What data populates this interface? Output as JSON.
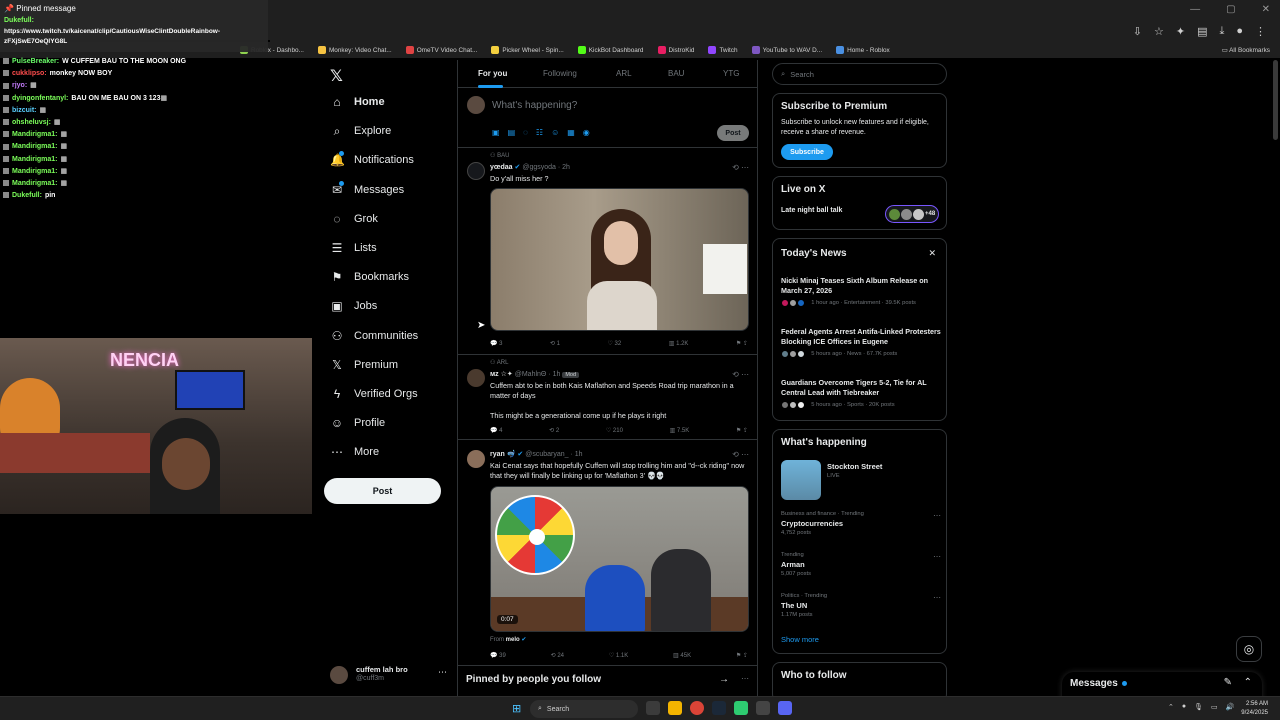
{
  "browser": {
    "bookmarks": [
      "Monkey: Video Chat...",
      "OmeTV Video Chat...",
      "Picker Wheel - Spin...",
      "KickBot Dashboard",
      "DistroKid",
      "Twitch",
      "YouTube to WAV D...",
      "Home - Roblox"
    ],
    "bookmark_partial": "Roblox - Dashbo...",
    "all_bookmarks": "All Bookmarks"
  },
  "chat": {
    "pinned_title": "Pinned message",
    "pinned_user": "Dukefull:",
    "pinned_text": "https://www.twitch.tv/kaicenat/clip/CautiousWiseClintDoubleRainbow-zFXjSwE7OeQlYG8L",
    "lines": [
      {
        "user": "PulseBreaker:",
        "color": "#6bff6b",
        "text": "W CUFFEM BAU TO THE MOON ONG"
      },
      {
        "user": "cukklipso:",
        "color": "#ff4d4d",
        "text": "monkey NOW BOY"
      },
      {
        "user": "rjyo:",
        "color": "#c77dff",
        "text": "▦"
      },
      {
        "user": "dyingonfentanyl:",
        "color": "#7cff5a",
        "text": "BAU ON ME BAU ON 3 123▦"
      },
      {
        "user": "bizcuit:",
        "color": "#5ad1ff",
        "text": "▦"
      },
      {
        "user": "ohsheluvsj:",
        "color": "#7cff5a",
        "text": "▦"
      },
      {
        "user": "Mandirigma1:",
        "color": "#7cff5a",
        "text": "▦"
      },
      {
        "user": "Mandirigma1:",
        "color": "#7cff5a",
        "text": "▦"
      },
      {
        "user": "Mandirigma1:",
        "color": "#7cff5a",
        "text": "▦"
      },
      {
        "user": "Mandirigma1:",
        "color": "#7cff5a",
        "text": "▦"
      },
      {
        "user": "Mandirigma1:",
        "color": "#7cff5a",
        "text": "▦"
      },
      {
        "user": "Dukefull:",
        "color": "#7cff5a",
        "text": "pin"
      }
    ]
  },
  "webcam": {
    "neon": "NENCIA"
  },
  "sidebar": {
    "items": [
      {
        "label": "Home",
        "icon": "home-icon",
        "glyph": "⌂",
        "active": true
      },
      {
        "label": "Explore",
        "icon": "search-icon",
        "glyph": "⌕"
      },
      {
        "label": "Notifications",
        "icon": "bell-icon",
        "glyph": "🔔",
        "dot": true
      },
      {
        "label": "Messages",
        "icon": "envelope-icon",
        "glyph": "✉",
        "dot": true
      },
      {
        "label": "Grok",
        "icon": "grok-icon",
        "glyph": "◌"
      },
      {
        "label": "Lists",
        "icon": "list-icon",
        "glyph": "☰"
      },
      {
        "label": "Bookmarks",
        "icon": "bookmark-icon",
        "glyph": "⚑"
      },
      {
        "label": "Jobs",
        "icon": "briefcase-icon",
        "glyph": "▣"
      },
      {
        "label": "Communities",
        "icon": "communities-icon",
        "glyph": "⚇"
      },
      {
        "label": "Premium",
        "icon": "x-premium-icon",
        "glyph": "𝕏"
      },
      {
        "label": "Verified Orgs",
        "icon": "lightning-icon",
        "glyph": "ϟ"
      },
      {
        "label": "Profile",
        "icon": "profile-icon",
        "glyph": "☺"
      },
      {
        "label": "More",
        "icon": "more-circle-icon",
        "glyph": "⋯"
      }
    ],
    "post_label": "Post",
    "account": {
      "name": "cuffem lah bro",
      "handle": "@cuff3m"
    }
  },
  "feed": {
    "tabs": [
      "For you",
      "Following",
      "ARL",
      "BAU",
      "YTG"
    ],
    "composer_placeholder": "What's happening?",
    "composer_post": "Post",
    "tweets": [
      {
        "context": "BAU",
        "name": "yœdaa",
        "handle": "@ggsyoda · 2h",
        "text": "Do y'all miss her ?",
        "actions": [
          "3",
          "1",
          "32",
          "1.2K"
        ]
      },
      {
        "context": "ARL",
        "name": "мz",
        "badge": "Mod",
        "handle": "@MahlnΘ · 1h",
        "text": "Cuffem abt to be in both Kais Maflathon and Speeds Road trip marathon in a matter of days",
        "text2": "This might be a generational come up if he plays it right",
        "actions": [
          "4",
          "2",
          "210",
          "7.5K"
        ]
      },
      {
        "name": "ryan",
        "handle": "@scubaryan_ · 1h",
        "text": "Kai Cenat says that hopefully Cuffem will stop trolling him and \"d--ck riding\" now that they will finally be linking up for 'Maflathon 3' 💀💀",
        "duration": "0:07",
        "from_label": "From",
        "from_user": "melo",
        "actions": [
          "39",
          "24",
          "1.1K",
          "45K"
        ]
      }
    ],
    "pinned_follow": "Pinned by people you follow"
  },
  "right": {
    "search_placeholder": "Search",
    "premium": {
      "title": "Subscribe to Premium",
      "text": "Subscribe to unlock new features and if eligible, receive a share of revenue.",
      "button": "Subscribe"
    },
    "live": {
      "title": "Live on X",
      "label": "Late night ball talk",
      "count": "+48"
    },
    "news": {
      "title": "Today's News",
      "items": [
        {
          "title": "Nicki Minaj Teases Sixth Album Release on March 27, 2026",
          "meta": "1 hour ago · Entertainment · 39.5K posts"
        },
        {
          "title": "Federal Agents Arrest Antifa-Linked Protesters Blocking ICE Offices in Eugene",
          "meta": "5 hours ago · News · 67.7K posts"
        },
        {
          "title": "Guardians Overcome Tigers 5-2, Tie for AL Central Lead with Tiebreaker",
          "meta": "5 hours ago · Sports · 20K posts"
        }
      ]
    },
    "happening": {
      "title": "What's happening",
      "live_name": "Stockton Street",
      "live_tag": "LIVE",
      "trends": [
        {
          "cat": "Business and finance · Trending",
          "name": "Cryptocurrencies",
          "count": "4,752 posts"
        },
        {
          "cat": "Trending",
          "name": "Arman",
          "count": "5,007 posts"
        },
        {
          "cat": "Politics · Trending",
          "name": "The UN",
          "count": "1.17M posts"
        }
      ],
      "show_more": "Show more"
    },
    "who_to_follow": "Who to follow"
  },
  "messages_drawer": {
    "title": "Messages"
  },
  "taskbar": {
    "search": "Search",
    "time": "2:56 AM",
    "date": "9/24/2025"
  },
  "colors": {
    "accent": "#1d9bf0",
    "bg": "#000000",
    "border": "#2f3336"
  }
}
